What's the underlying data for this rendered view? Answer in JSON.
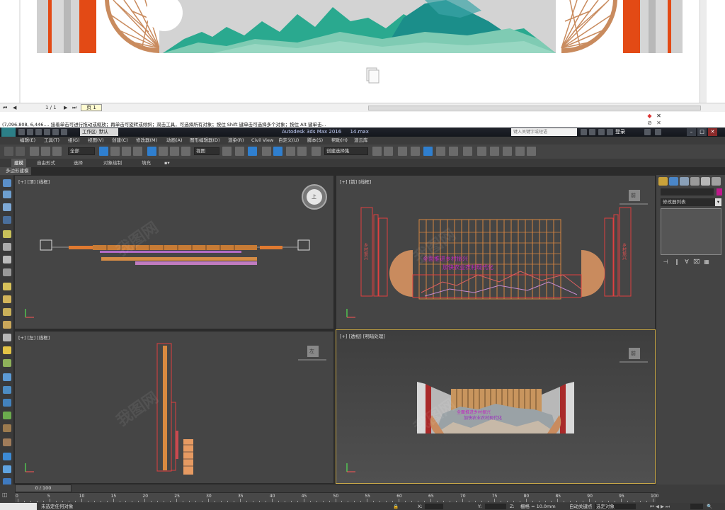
{
  "preview": {
    "page_indicator": "1 / 1",
    "page_tab": "页 1",
    "colors": {
      "orange": "#e34a15",
      "grey": "#c8c8c8",
      "teal": "#2aa98f",
      "mint": "#7fcbb3",
      "wood": "#c98b5e"
    }
  },
  "statusline": {
    "coords": "(7,096.808, 6,446....",
    "hint": "接着单击可进行拖动或缩放；再单击可旋转或倾斜；双击工具，可选择所有对象；按住 Shift 键单击可选择多个对象；按住 Alt 键单击..."
  },
  "titlebar": {
    "logo": "MAX",
    "workspace": "工作区: 默认",
    "title": "Autodesk 3ds Max 2016",
    "file": "14.max",
    "search_placeholder": "键入关键字或短语",
    "login": "登录"
  },
  "menus": [
    "编辑(E)",
    "工具(T)",
    "组(G)",
    "视图(V)",
    "创建(C)",
    "修改器(M)",
    "动画(A)",
    "图形编辑器(D)",
    "渲染(R)",
    "Civil View",
    "自定义(U)",
    "脚本(S)",
    "帮助(H)",
    "渲云库"
  ],
  "toolbar": {
    "selection_filter": "全部",
    "ref_coord": "视图",
    "named_selection": "创建选择集"
  },
  "ribbon": {
    "tabs": [
      "建模",
      "自由形式",
      "选择",
      "对象绘制",
      "填充"
    ],
    "subpanel": "多边形建模"
  },
  "viewports": {
    "top": {
      "label": "[+] [顶] [线框]",
      "cube": "上"
    },
    "front": {
      "label": "[+] [前] [线框]",
      "cube": "前"
    },
    "left": {
      "label": "[+] [左] [线框]",
      "cube": "左"
    },
    "persp": {
      "label": "[+] [透视] [明暗处理]",
      "cube": "前"
    }
  },
  "cmdpanel": {
    "modifier_list": "修改器列表",
    "accent_color": "#c0188c"
  },
  "timeline": {
    "frame": "0 / 100",
    "ticks": [
      0,
      5,
      10,
      15,
      20,
      25,
      30,
      35,
      40,
      45,
      50,
      55,
      60,
      65,
      70,
      75,
      80,
      85,
      90,
      95,
      100
    ]
  },
  "statusbar": {
    "message": "未选定任何对象",
    "x_label": "X:",
    "y_label": "Y:",
    "z_label": "Z:",
    "grid": "栅格 = 10.0mm",
    "auto_key": "自动关键点",
    "selected_set": "选定对象"
  }
}
